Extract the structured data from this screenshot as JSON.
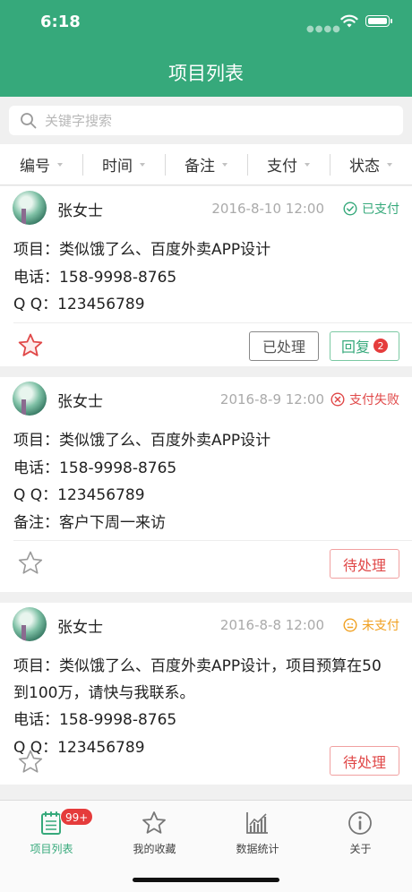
{
  "status_bar": {
    "time": "6:18"
  },
  "header": {
    "title": "项目列表"
  },
  "search": {
    "placeholder": "关键字搜索"
  },
  "filters": [
    "编号",
    "时间",
    "备注",
    "支付",
    "状态"
  ],
  "colors": {
    "brand": "#36a97b",
    "paid": "#36a97b",
    "failed": "#e04848",
    "unpaid": "#f0a020"
  },
  "cards": [
    {
      "name": "张女士",
      "time": "2016-8-10 12:00",
      "status": "已支付",
      "status_icon": "check-circle-icon",
      "project": "项目：类似饿了么、百度外卖APP设计",
      "phone": "电话：158-9998-8765",
      "qq": "Q Q：123456789",
      "starred": true,
      "buttons": [
        "已处理",
        "回复"
      ],
      "reply_badge": "2"
    },
    {
      "name": "张女士",
      "time": "2016-8-9 12:00",
      "status": "支付失败",
      "status_icon": "x-circle-icon",
      "project": "项目：类似饿了么、百度外卖APP设计",
      "phone": "电话：158-9998-8765",
      "qq": "Q Q：123456789",
      "note": "备注：客户下周一来访",
      "starred": false,
      "buttons": [
        "待处理"
      ]
    },
    {
      "name": "张女士",
      "time": "2016-8-8 12:00",
      "status": "未支付",
      "status_icon": "neutral-face-icon",
      "project": "项目：类似饿了么、百度外卖APP设计，项目预算在50到100万，请快与我联系。",
      "phone": "电话：158-9998-8765",
      "qq": "Q Q：123456789",
      "starred": false,
      "buttons": [
        "待处理"
      ]
    }
  ],
  "tabs": [
    {
      "label": "项目列表",
      "icon": "list-document-icon",
      "badge": "99+",
      "active": true
    },
    {
      "label": "我的收藏",
      "icon": "star-icon"
    },
    {
      "label": "数据统计",
      "icon": "chart-icon"
    },
    {
      "label": "关于",
      "icon": "info-icon"
    }
  ]
}
